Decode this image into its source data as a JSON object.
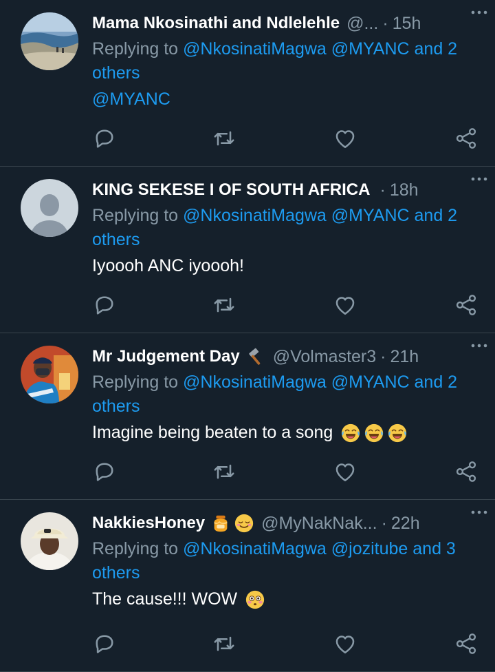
{
  "tweets": [
    {
      "name": "Mama Nkosinathi and Ndlelehle",
      "handle": "@...",
      "dot": "·",
      "time": "15h",
      "replying_prefix": "Replying to ",
      "replying_mentions": "@NkosinatiMagwa @MYANC",
      "replying_and": " and 2",
      "replying_others": "others",
      "text": "@MYANC",
      "text_is_mention": true,
      "emojis": []
    },
    {
      "name": "KING SEKESE I OF SOUTH AFRICA",
      "handle": "",
      "dot": "·",
      "time": "18h",
      "replying_prefix": "Replying to ",
      "replying_mentions": "@NkosinatiMagwa @MYANC",
      "replying_and": " and 2",
      "replying_others": "others",
      "text": "Iyoooh ANC iyoooh!",
      "text_is_mention": false,
      "emojis": []
    },
    {
      "name": "Mr Judgement Day",
      "handle": "@Volmaster3",
      "dot": "·",
      "time": "21h",
      "replying_prefix": "Replying to ",
      "replying_mentions": "@NkosinatiMagwa @MYANC",
      "replying_and": " and 2",
      "replying_others": "others",
      "text": "Imagine being beaten to a song",
      "text_is_mention": false,
      "emojis": [
        "tears-of-joy-emoji",
        "tears-of-joy-emoji",
        "tears-of-joy-emoji"
      ]
    },
    {
      "name": "NakkiesHoney",
      "handle": "@MyNakNak...",
      "dot": "·",
      "time": "22h",
      "replying_prefix": "Replying to ",
      "replying_mentions": "@NkosinatiMagwa @jozitube",
      "replying_and": " and 3",
      "replying_others": "others",
      "text": "The cause!!! WOW",
      "text_is_mention": false,
      "emojis": [
        "flushed-face-emoji"
      ]
    }
  ],
  "colors": {
    "background": "#15202b",
    "muted": "#8899a6",
    "accent": "#1d9bf0",
    "divider": "#38444d"
  },
  "icons": {
    "reply": "reply-icon",
    "retweet": "retweet-icon",
    "like": "heart-icon",
    "share": "share-icon",
    "more": "more-icon"
  }
}
